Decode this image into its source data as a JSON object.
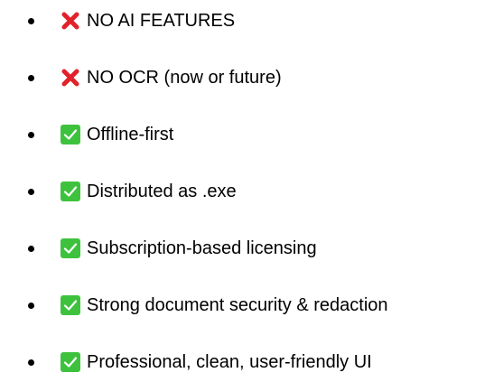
{
  "colors": {
    "cross": "#e2222a",
    "check_bg": "#3ec23e",
    "check_mark": "#ffffff",
    "text": "#000000"
  },
  "items": [
    {
      "icon": "cross-mark-icon",
      "text": "NO AI FEATURES"
    },
    {
      "icon": "cross-mark-icon",
      "text": "NO OCR (now or future)"
    },
    {
      "icon": "check-mark-icon",
      "text": "Offline-first"
    },
    {
      "icon": "check-mark-icon",
      "text": "Distributed as .exe"
    },
    {
      "icon": "check-mark-icon",
      "text": "Subscription-based licensing"
    },
    {
      "icon": "check-mark-icon",
      "text": "Strong document security & redaction"
    },
    {
      "icon": "check-mark-icon",
      "text": "Professional, clean, user-friendly UI"
    }
  ]
}
